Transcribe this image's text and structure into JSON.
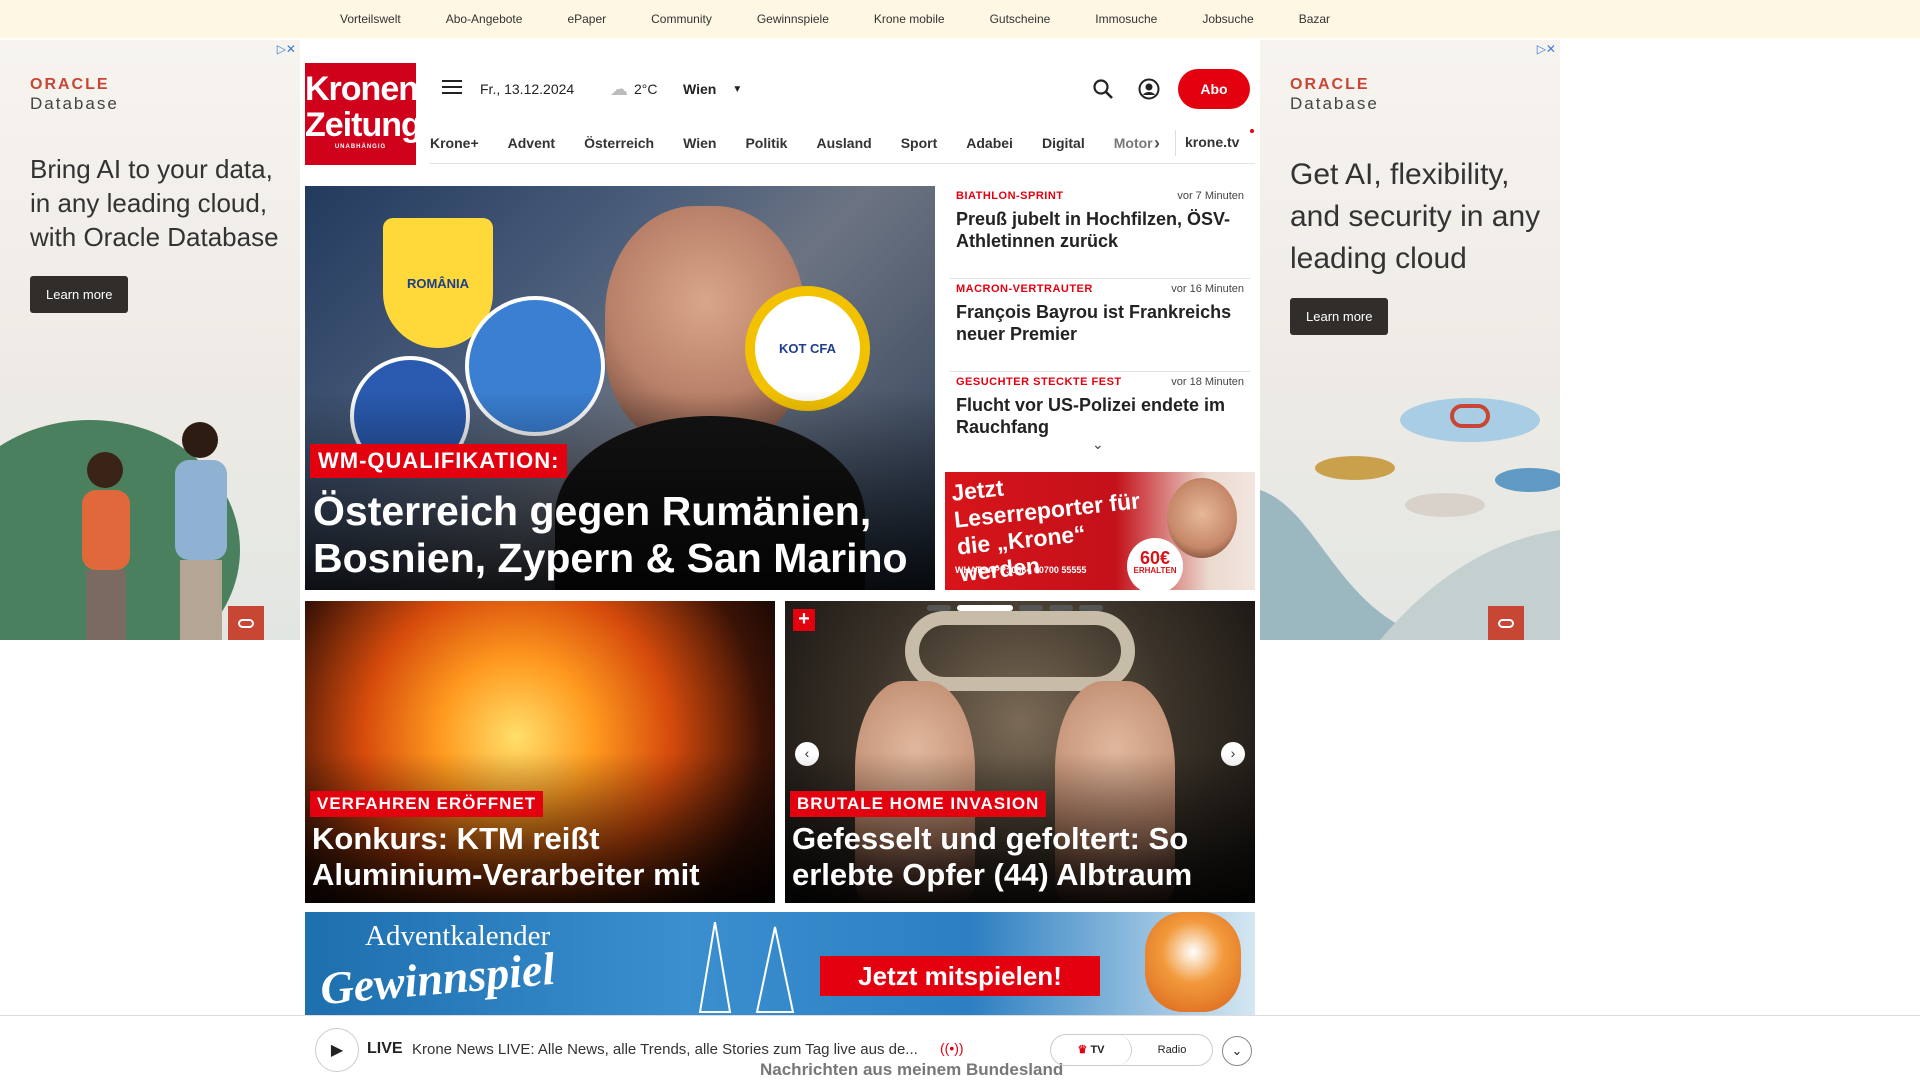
{
  "topbar": {
    "links": [
      "Vorteilswelt",
      "Abo-Angebote",
      "ePaper",
      "Community",
      "Gewinnspiele",
      "Krone mobile",
      "Gutscheine",
      "Immosuche",
      "Jobsuche",
      "Bazar"
    ]
  },
  "ad_left": {
    "brand_line1": "ORACLE",
    "brand_line2": "Database",
    "headline": "Bring AI to your data, in any leading cloud, with Oracle Database",
    "cta": "Learn more",
    "close": "▷✕"
  },
  "ad_right": {
    "brand_line1": "ORACLE",
    "brand_line2": "Database",
    "headline": "Get AI, flexibility, and security in any leading cloud",
    "cta": "Learn more",
    "close": "▷✕"
  },
  "header": {
    "logo_line1": "Kronen",
    "logo_line2": "Zeitung",
    "logo_tagline": "UNABHÄNGIG",
    "date": "Fr., 13.12.2024",
    "temperature": "2°C",
    "city": "Wien",
    "subscribe": "Abo"
  },
  "nav": {
    "items": [
      "Krone+",
      "Advent",
      "Österreich",
      "Wien",
      "Politik",
      "Ausland",
      "Sport",
      "Adabei",
      "Digital",
      "Motor"
    ],
    "tv": "krone.tv"
  },
  "hero": {
    "kicker": "WM-QUALIFIKATION:",
    "title": "Österreich gegen Rumänien, Bosnien, Zypern & San Marino",
    "crests": [
      "ROMÂNIA",
      "KOT CFA"
    ]
  },
  "news": [
    {
      "kicker": "BIATHLON-SPRINT",
      "time": "vor 7 Minuten",
      "title": "Preuß jubelt in Hochfilzen, ÖSV-Athletinnen zurück"
    },
    {
      "kicker": "MACRON-VERTRAUTER",
      "time": "vor 16 Minuten",
      "title": "François Bayrou ist Frankreichs neuer Premier"
    },
    {
      "kicker": "GESUCHTER STECKTE FEST",
      "time": "vor 18 Minuten",
      "title": "Flucht vor US-Polizei endete im Rauchfang"
    }
  ],
  "promo": {
    "text": "Jetzt Leserreporter für die „Krone“ werden",
    "whatsapp": "WHATSAPP: 0664 60700 55555",
    "amount": "60€",
    "amount_label": "ERHALTEN"
  },
  "cards": [
    {
      "kicker": "VERFAHREN ERÖFFNET",
      "title": "Konkurs: KTM reißt Aluminium-Verarbeiter mit"
    },
    {
      "kicker": "BRUTALE HOME INVASION",
      "title": "Gefesselt und gefoltert: So erlebte Opfer (44) Albtraum"
    }
  ],
  "advent": {
    "line1": "Adventkalender",
    "line2": "Gewinnspiel",
    "cta": "Jetzt mitspielen!"
  },
  "player": {
    "live": "LIVE",
    "text": "Krone News LIVE: Alle News, alle Trends, alle Stories zum Tag live aus de...",
    "tv": "TV",
    "radio": "Radio",
    "below": "Nachrichten aus meinem Bundesland"
  }
}
